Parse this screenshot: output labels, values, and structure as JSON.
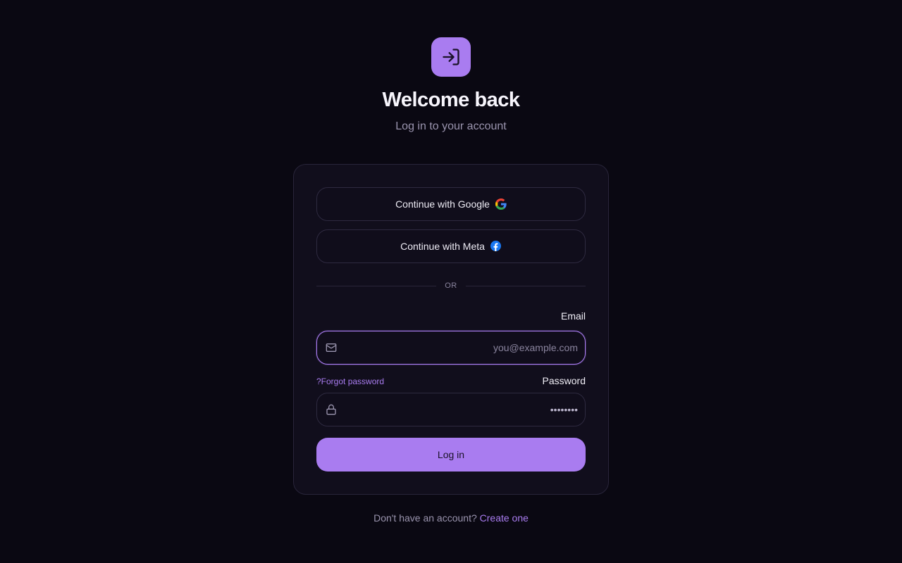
{
  "header": {
    "logo_icon": "login-icon",
    "title": "Welcome back",
    "subtitle": "Log in to your account"
  },
  "social": {
    "google_label": "Continue with Google",
    "google_icon": "google-icon",
    "meta_label": "Continue with Meta",
    "meta_icon": "facebook-icon"
  },
  "divider": {
    "text": "OR"
  },
  "form": {
    "email_label": "Email",
    "email_placeholder": "you@example.com",
    "email_icon": "mail-icon",
    "forgot_label": "?Forgot password",
    "password_label": "Password",
    "password_value": "••••••••",
    "password_icon": "lock-icon",
    "submit_label": "Log in"
  },
  "footer": {
    "prompt": "Don't have an account?",
    "link": "Create one"
  },
  "colors": {
    "background": "#0a0812",
    "card": "#110e1c",
    "accent": "#a97cf0",
    "muted_text": "#9a94ae"
  }
}
